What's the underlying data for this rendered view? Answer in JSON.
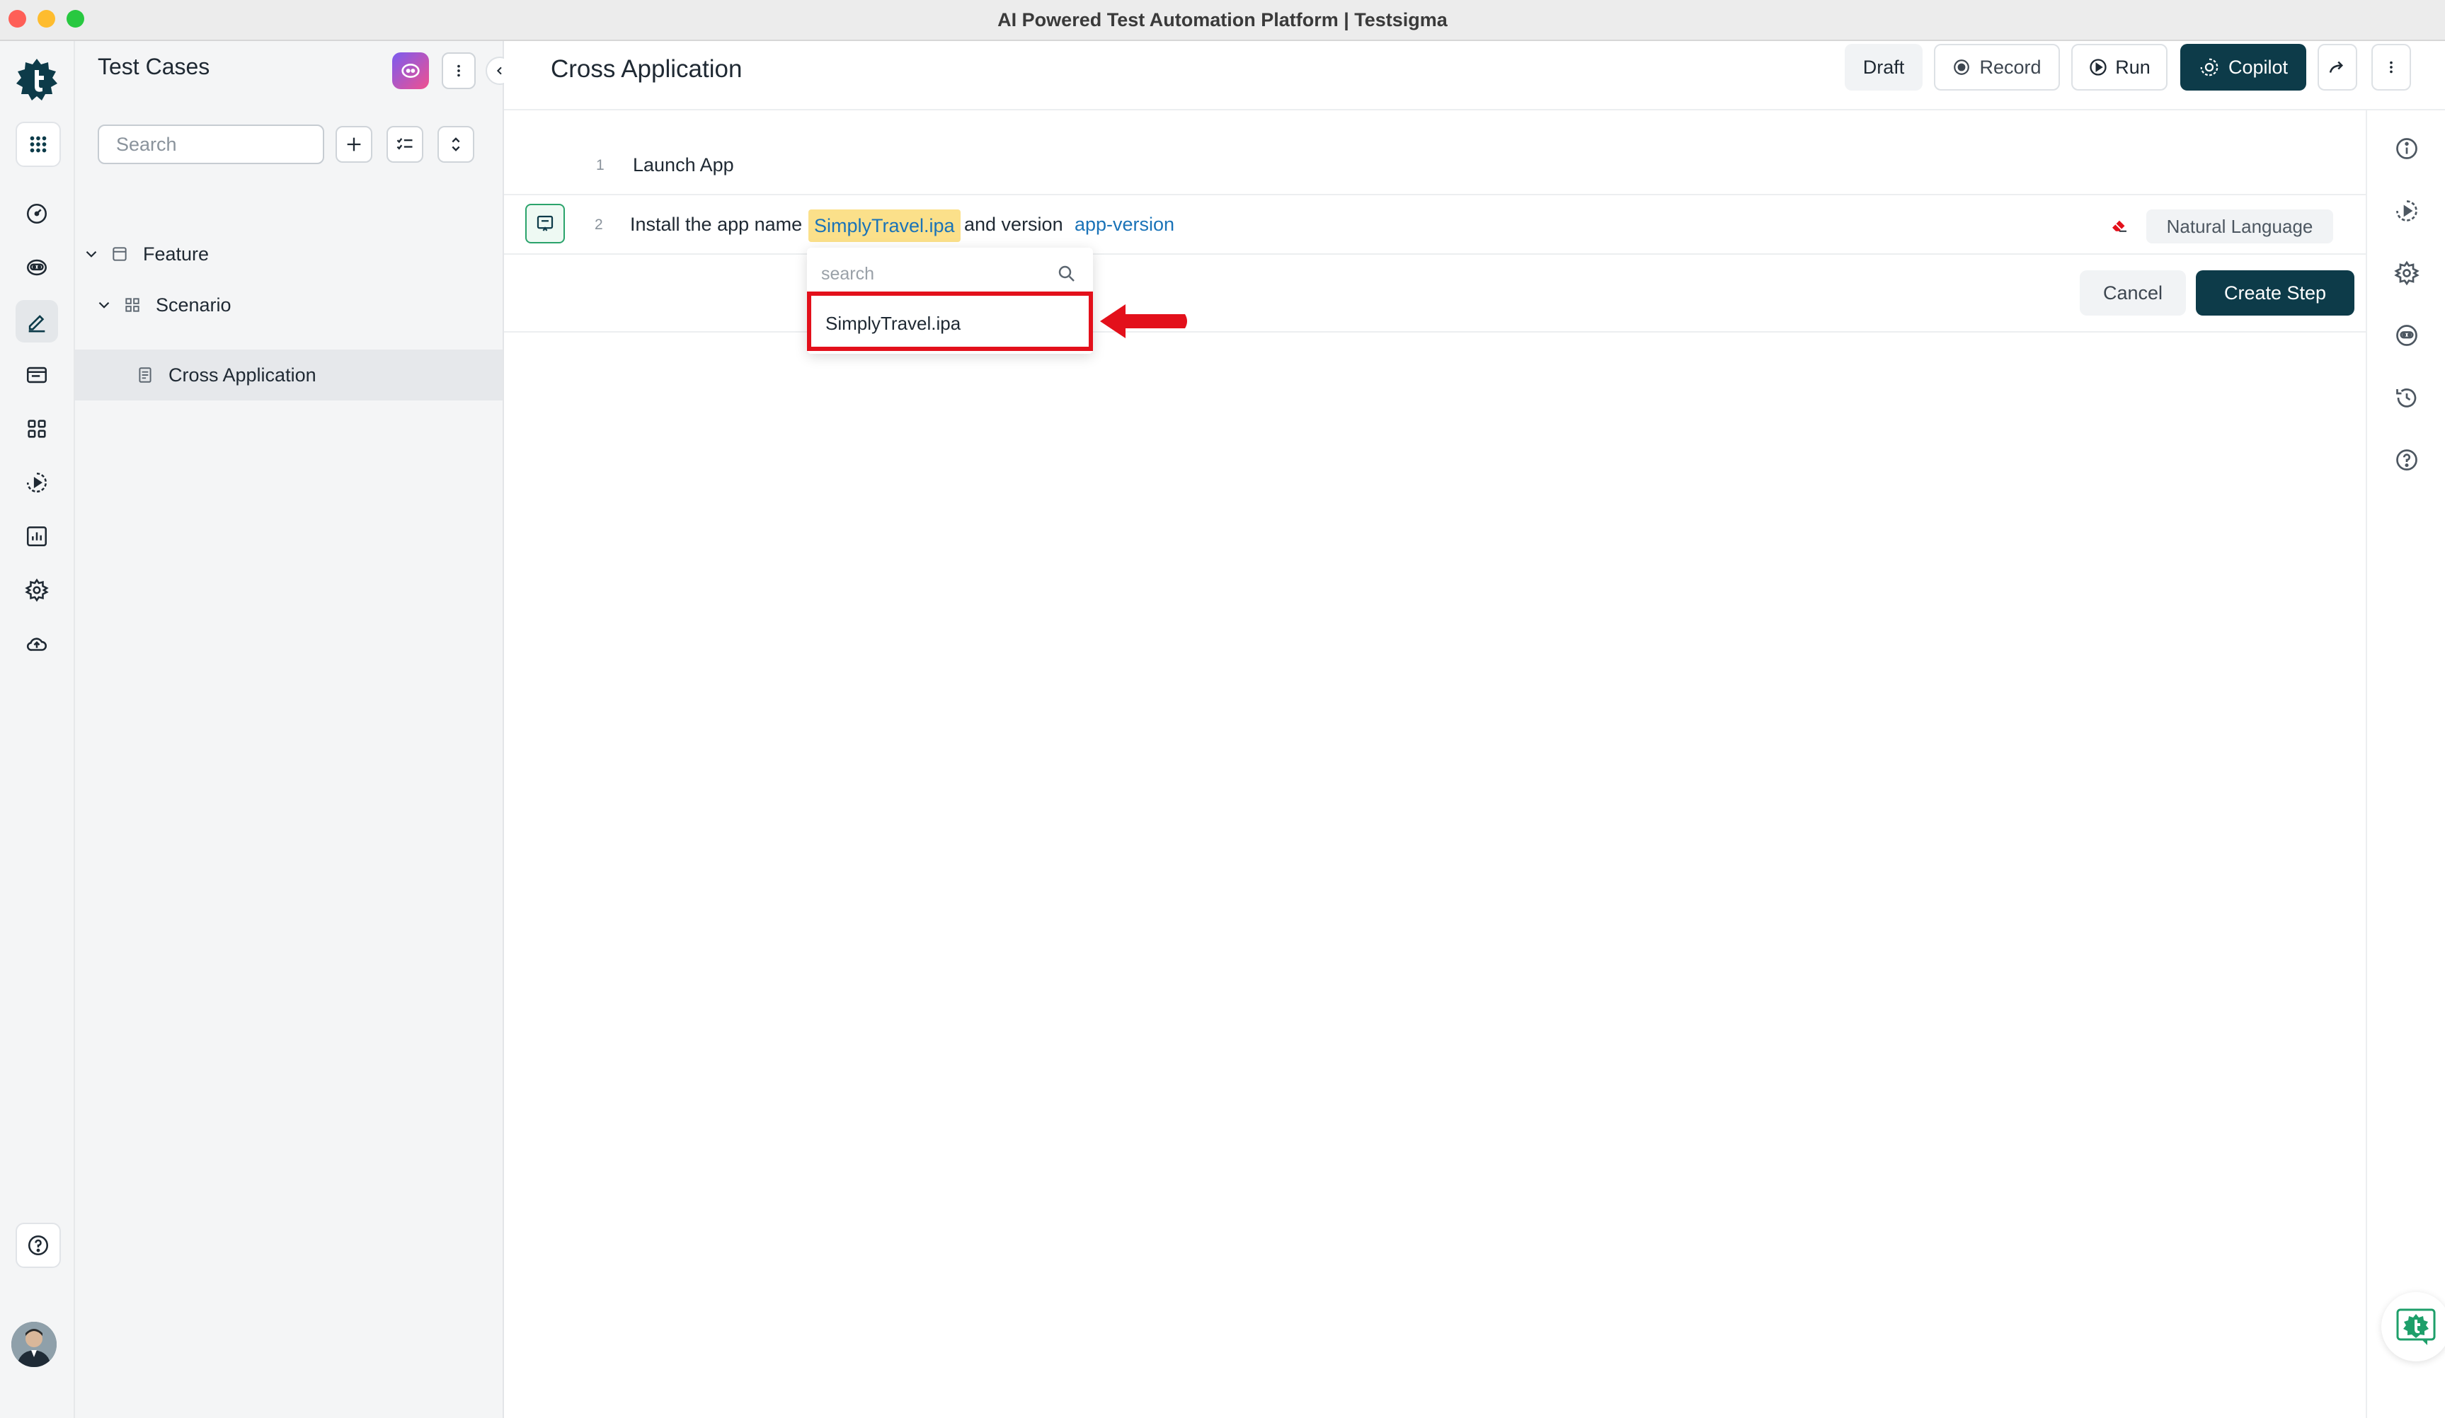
{
  "window": {
    "title": "AI Powered Test Automation Platform | Testsigma"
  },
  "colors": {
    "brand": "#0d3b49",
    "accent_link": "#1a73b8",
    "highlight_chip": "#fbe08a",
    "annotation_red": "#e3101b",
    "ai_gradient_start": "#7b5cf0",
    "ai_gradient_end": "#f0508f"
  },
  "rail": {
    "logo": "testsigma-logo-icon",
    "items": [
      "apps-grid-icon",
      "dashboard-gauge-icon",
      "ai-agent-icon",
      "test-cases-pencil-icon",
      "test-data-icon",
      "elements-grid-icon",
      "run-plans-icon",
      "reports-chart-icon",
      "settings-gear-icon",
      "cloud-upload-icon"
    ],
    "bottom": [
      "help-icon",
      "user-avatar"
    ]
  },
  "panel": {
    "title": "Test Cases",
    "search_placeholder": "Search",
    "tree": [
      {
        "label": "Feature",
        "level": 0
      },
      {
        "label": "Scenario",
        "level": 1
      },
      {
        "label": "Cross Application",
        "level": 2,
        "selected": true
      }
    ]
  },
  "header": {
    "title": "Cross Application",
    "draft_label": "Draft",
    "record_label": "Record",
    "run_label": "Run",
    "copilot_label": "Copilot"
  },
  "steps": [
    {
      "number": "1",
      "text": "Launch App"
    },
    {
      "number": "2",
      "prefix": "Install the app name",
      "param_value": "SimplyTravel.ipa",
      "middle": "and version",
      "param2": "app-version",
      "mode": "Natural Language"
    }
  ],
  "actions": {
    "cancel_label": "Cancel",
    "create_label": "Create Step"
  },
  "dropdown": {
    "search_placeholder": "search",
    "option": "SimplyTravel.ipa"
  }
}
